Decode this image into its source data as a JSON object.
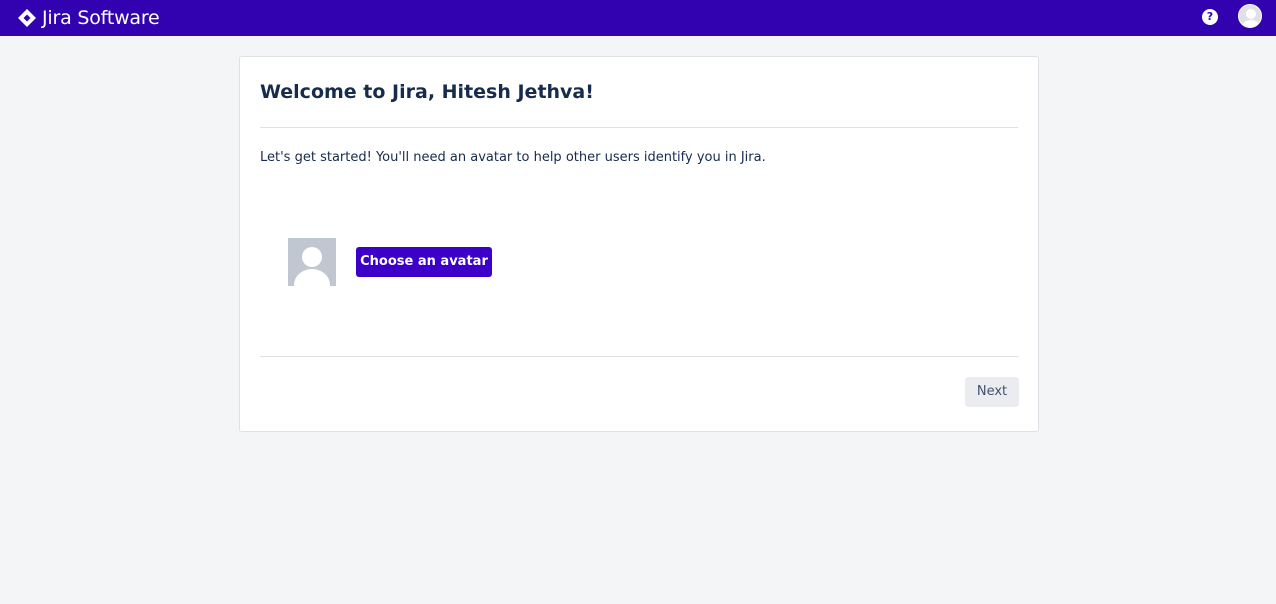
{
  "app": {
    "product_name": "Jira Software",
    "brand_color": "#3302b0",
    "logo_icon": "jira-diamond-icon"
  },
  "topbar": {
    "help_icon": "question-circle-icon",
    "help_glyph": "?",
    "profile_icon": "user-avatar-icon"
  },
  "onboarding": {
    "title": "Welcome to Jira, Hitesh Jethva!",
    "intro": "Let's get started! You'll need an avatar to help other users identify you in Jira.",
    "avatar_icon": "default-avatar-icon",
    "choose_avatar_label": "Choose an avatar",
    "next_label": "Next"
  }
}
